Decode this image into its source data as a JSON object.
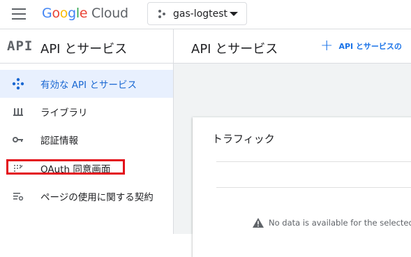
{
  "header": {
    "logo": {
      "google": "Google",
      "cloud": "Cloud"
    },
    "project": {
      "name": "gas-logtest"
    }
  },
  "sidebar": {
    "icon_text": "API",
    "title": "API とサービス",
    "items": [
      {
        "label": "有効な API とサービス",
        "icon": "diamond-dots-icon",
        "active": true
      },
      {
        "label": "ライブラリ",
        "icon": "library-icon",
        "active": false
      },
      {
        "label": "認証情報",
        "icon": "key-icon",
        "active": false
      },
      {
        "label": "OAuth 同意画面",
        "icon": "oauth-consent-icon",
        "active": false
      },
      {
        "label": "ページの使用に関する契約",
        "icon": "settings-list-icon",
        "active": false
      }
    ]
  },
  "main": {
    "title": "API とサービス",
    "enable_button": "API とサービスの",
    "card": {
      "title": "トラフィック",
      "no_data": "No data is available for the selected"
    }
  },
  "colors": {
    "accent": "#1a73e8",
    "active_bg": "#e8f0fe",
    "highlight": "#e3101a"
  }
}
